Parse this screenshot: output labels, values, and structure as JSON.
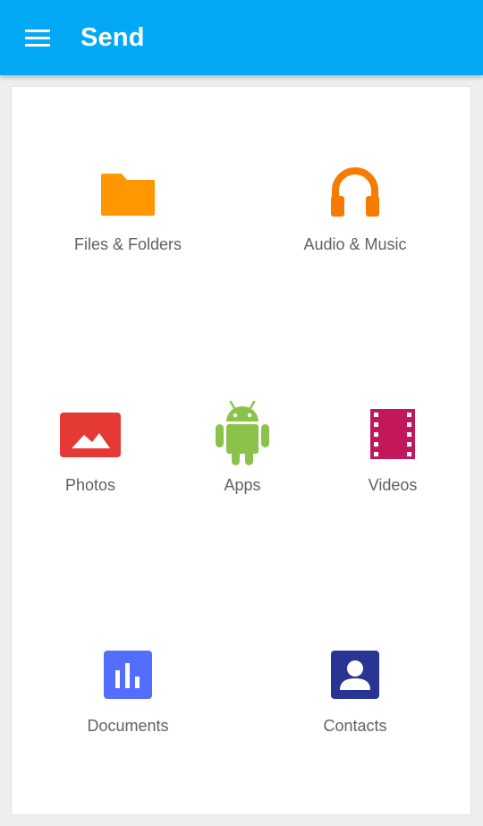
{
  "appbar": {
    "title": "Send",
    "color": "#03a9f4",
    "menu_icon": "hamburger-menu-icon"
  },
  "categories": [
    {
      "label": "Files & Folders",
      "icon": "folder-icon",
      "color": "#ff9800"
    },
    {
      "label": "Audio & Music",
      "icon": "headphones-icon",
      "color": "#f57c00"
    },
    {
      "label": "Photos",
      "icon": "image-icon",
      "color": "#e53935"
    },
    {
      "label": "Apps",
      "icon": "android-icon",
      "color": "#8bc34a"
    },
    {
      "label": "Videos",
      "icon": "film-icon",
      "color": "#c2185b"
    },
    {
      "label": "Documents",
      "icon": "bar-chart-doc-icon",
      "color": "#536dfe"
    },
    {
      "label": "Contacts",
      "icon": "contact-card-icon",
      "color": "#283593"
    }
  ]
}
